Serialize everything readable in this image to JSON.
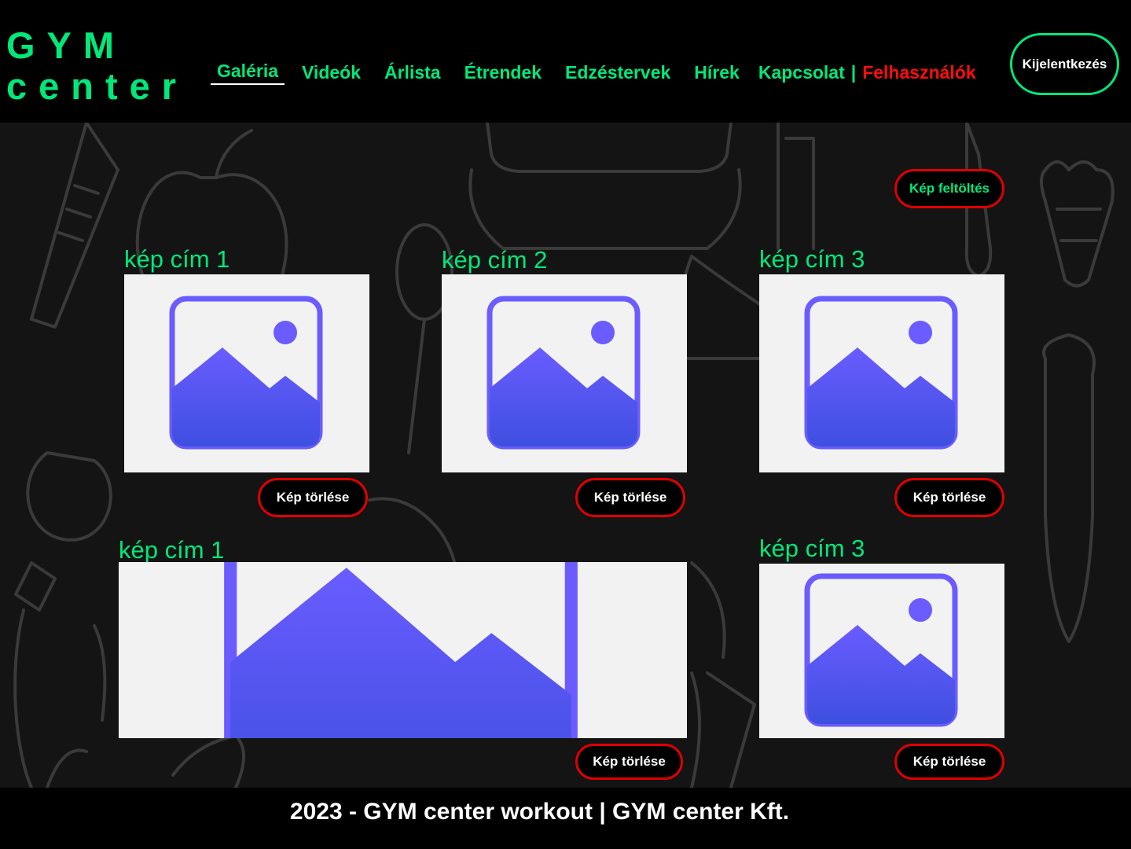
{
  "logo": {
    "line1": "GYM",
    "line2": "center"
  },
  "nav": {
    "items": [
      "Galéria",
      "Videók",
      "Árlista",
      "Étrendek",
      "Edzéstervek",
      "Hírek",
      "Kapcsolat"
    ],
    "separator": "|",
    "users": "Felhasználók",
    "active": "Galéria"
  },
  "header": {
    "logout_label": "Kijelentkezés"
  },
  "gallery": {
    "upload_label": "Kép feltöltés",
    "delete_label": "Kép törlése",
    "cards": [
      {
        "title": "kép cím 1"
      },
      {
        "title": "kép cím 2"
      },
      {
        "title": "kép cím 3"
      },
      {
        "title": "kép cím 1"
      },
      {
        "title": "kép cím 3"
      }
    ]
  },
  "footer": {
    "text": "2023 - GYM center workout | GYM center Kft."
  },
  "colors": {
    "accent": "#00e87a",
    "danger": "#e00000",
    "users_link": "#ff0d0d",
    "placeholder_bg": "#f2f2f2",
    "icon_top": "#6a5cff",
    "icon_bottom": "#3e4fe0"
  },
  "icons": [
    "image-placeholder-icon"
  ]
}
